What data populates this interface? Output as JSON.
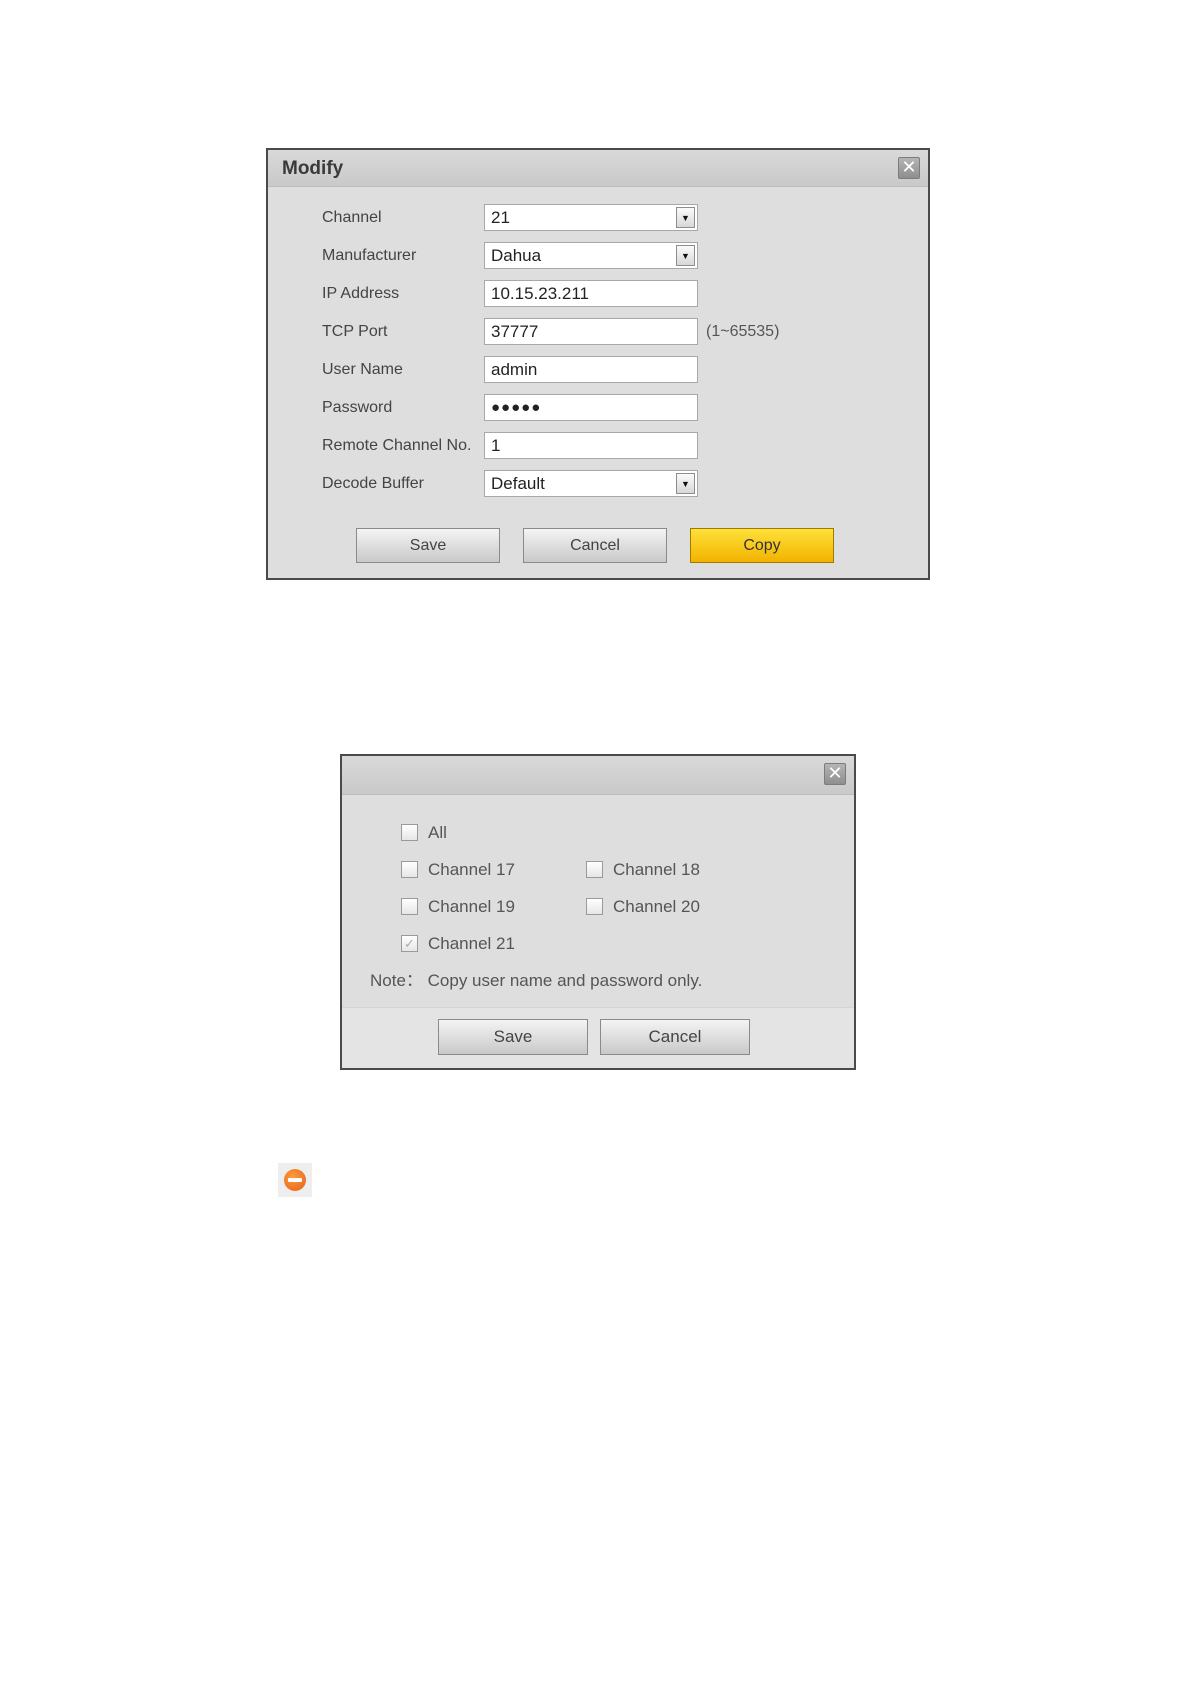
{
  "modify_dialog": {
    "title": "Modify",
    "close_glyph": "✕",
    "fields": {
      "channel": {
        "label": "Channel",
        "value": "21"
      },
      "manufacturer": {
        "label": "Manufacturer",
        "value": "Dahua"
      },
      "ip_address": {
        "label": "IP Address",
        "value": "10.15.23.211"
      },
      "tcp_port": {
        "label": "TCP Port",
        "value": "37777",
        "hint": "(1~65535)"
      },
      "user_name": {
        "label": "User Name",
        "value": "admin"
      },
      "password": {
        "label": "Password",
        "value": "●●●●●"
      },
      "remote_channel": {
        "label": "Remote Channel No.",
        "value": "1"
      },
      "decode_buffer": {
        "label": "Decode Buffer",
        "value": "Default"
      }
    },
    "buttons": {
      "save": "Save",
      "cancel": "Cancel",
      "copy": "Copy"
    }
  },
  "copy_dialog": {
    "close_glyph": "✕",
    "options": {
      "all": {
        "label": "All",
        "checked": false
      },
      "ch17": {
        "label": "Channel 17",
        "checked": false
      },
      "ch18": {
        "label": "Channel 18",
        "checked": false
      },
      "ch19": {
        "label": "Channel 19",
        "checked": false
      },
      "ch20": {
        "label": "Channel 20",
        "checked": false
      },
      "ch21": {
        "label": "Channel 21",
        "checked": true
      }
    },
    "note": "Note： Copy user name and password only.",
    "buttons": {
      "save": "Save",
      "cancel": "Cancel"
    },
    "check_glyph": "✓"
  },
  "icons": {
    "remove": "remove-icon"
  },
  "colors": {
    "accent_button": "#f7c600",
    "dialog_bg": "#dedede",
    "icon_orange": "#e8661f"
  }
}
